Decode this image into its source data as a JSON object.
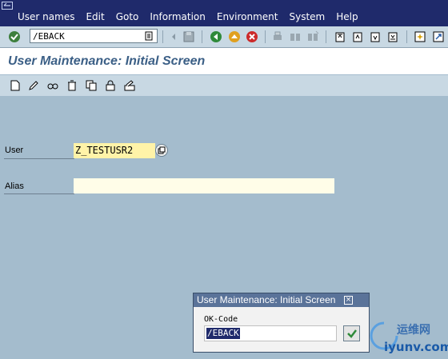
{
  "menu": {
    "items": [
      {
        "label": "User names",
        "icon": ""
      },
      {
        "label": "Edit"
      },
      {
        "label": "Goto"
      },
      {
        "label": "Information"
      },
      {
        "label": "Environment"
      },
      {
        "label": "System"
      },
      {
        "label": "Help"
      }
    ]
  },
  "toolbar": {
    "command_value": "/EBACK"
  },
  "screen": {
    "title": "User Maintenance: Initial Screen"
  },
  "form": {
    "user_label": "User",
    "user_value": "Z_TESTUSR2",
    "alias_label": "Alias",
    "alias_value": ""
  },
  "dialog": {
    "title": "User Maintenance: Initial Screen",
    "ok_label": "OK-Code",
    "ok_value": "/EBACK"
  },
  "watermark": {
    "text1": "运维网",
    "text2": "iyunv.com"
  },
  "colors": {
    "menubar": "#1f2a6b",
    "background": "#a4bccd",
    "title_text": "#3b5f86",
    "user_field": "#fff3a8"
  }
}
